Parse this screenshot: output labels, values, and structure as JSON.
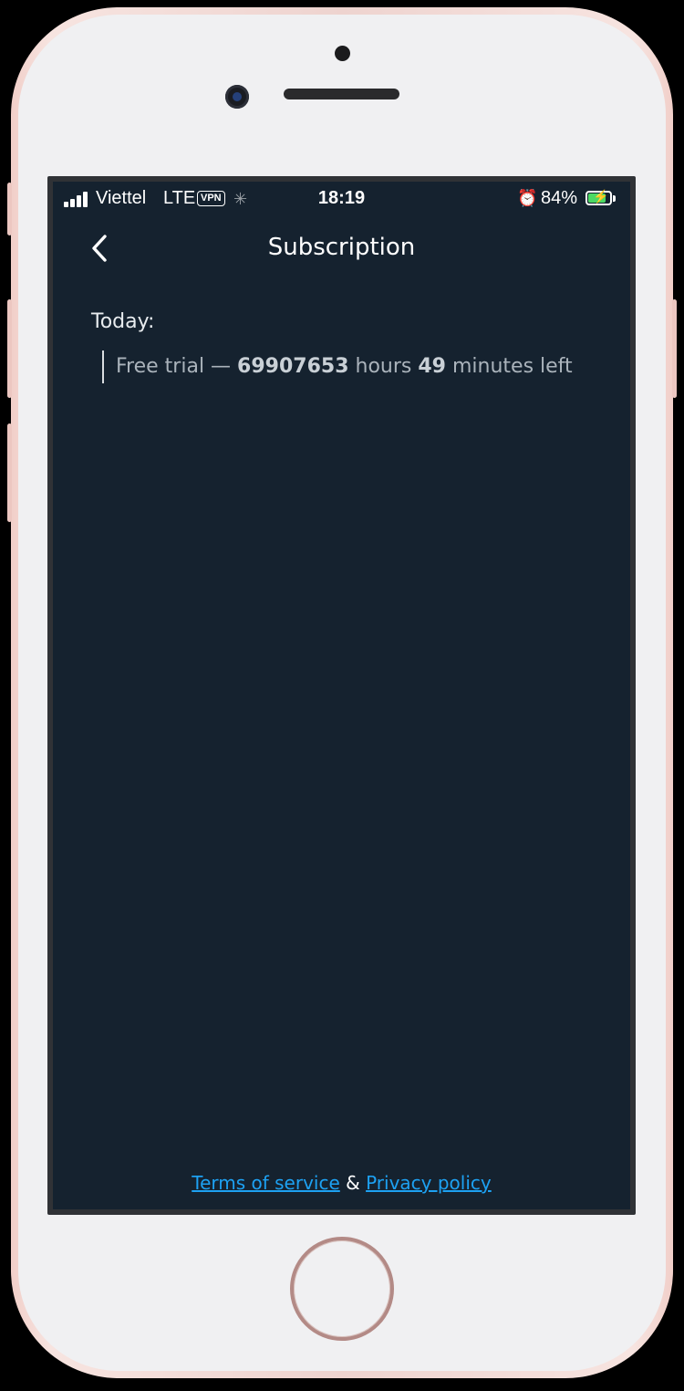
{
  "status_bar": {
    "carrier": "Viettel",
    "network": "LTE",
    "vpn": "VPN",
    "time": "18:19",
    "battery_percent": "84%",
    "battery_level": 0.84,
    "battery_color": "#4cd964",
    "icons": [
      "signal-icon",
      "spinner-icon",
      "alarm-icon",
      "battery-icon"
    ]
  },
  "nav": {
    "title": "Subscription",
    "back_icon": "chevron-left-icon"
  },
  "subscription": {
    "today_label": "Today:",
    "trial_prefix": "Free trial — ",
    "hours_value": "69907653",
    "hours_unit": " hours ",
    "minutes_value": "49",
    "minutes_unit": " minutes left"
  },
  "footer": {
    "terms_label": "Terms of service",
    "separator": " & ",
    "privacy_label": "Privacy policy",
    "link_color": "#1da1f2"
  },
  "theme": {
    "background": "#15222f",
    "device_color": "#f1cfc9"
  }
}
